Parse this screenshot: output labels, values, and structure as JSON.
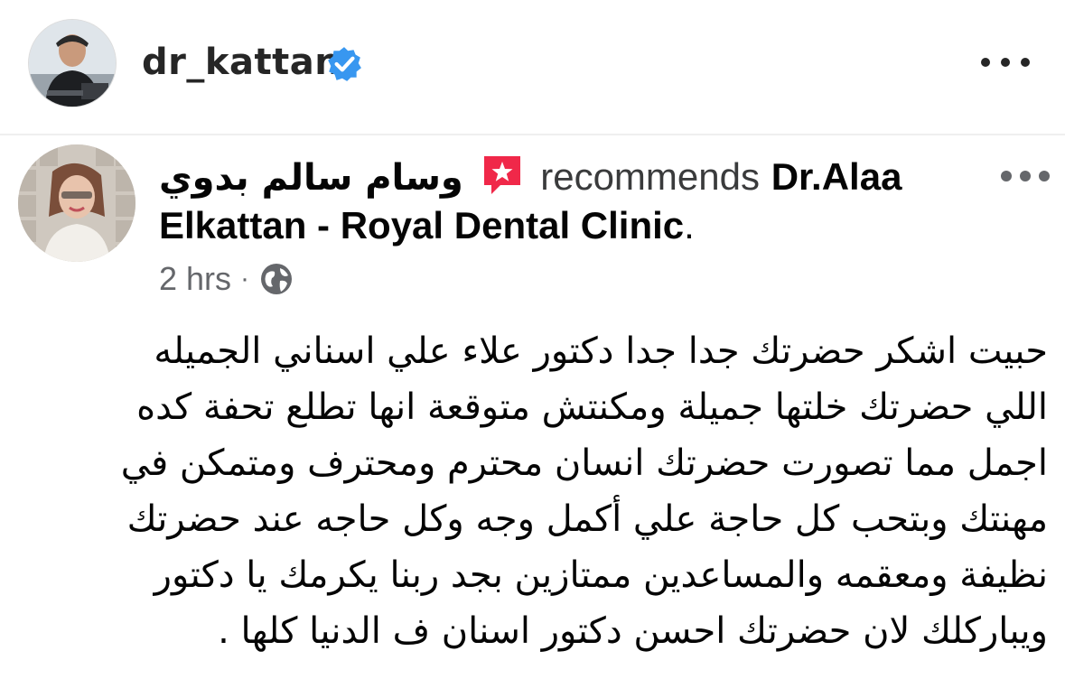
{
  "instagram": {
    "username": "dr_kattan",
    "verified": true,
    "avatar_icon": "profile-photo",
    "more_icon": "more-horizontal-icon",
    "verified_color": "#3897f0"
  },
  "post": {
    "author": "وسام سالم بدوي",
    "recommend_icon": "recommendation-badge-icon",
    "recommend_color": "#f02849",
    "recommends_text": "recommends",
    "page_name_part1": "Dr.Alaa",
    "page_name_part2": "Elkattan - Royal Dental Clinic",
    "page_name_period": ".",
    "time": "2 hrs",
    "separator": "·",
    "audience_icon": "globe-icon",
    "more_icon": "more-horizontal-icon",
    "body_lines": [
      "حبيت اشكر حضرتك جدا جدا دكتور علاء علي اسناني الجميله",
      "اللي حضرتك خلتها جميلة ومكنتش متوقعة انها تطلع تحفة كده",
      "اجمل مما تصورت حضرتك انسان محترم ومحترف ومتمكن في",
      "مهنتك وبتحب كل حاجة علي أكمل وجه وكل حاجه عند حضرتك",
      "نظيفة ومعقمه والمساعدين ممتازين بجد ربنا يكرمك يا دكتور",
      "ويباركلك لان حضرتك احسن دكتور اسنان ف الدنيا كلها ."
    ]
  }
}
